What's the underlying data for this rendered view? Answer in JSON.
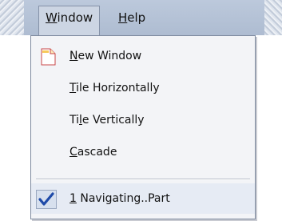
{
  "menubar": {
    "items": [
      {
        "label": "Window",
        "mnemonic": "W",
        "rest": "indow"
      },
      {
        "label": "Help",
        "mnemonic": "H",
        "rest": "elp"
      }
    ]
  },
  "window_menu": {
    "items": [
      {
        "label": "New Window",
        "mnemonic": "N",
        "rest": "ew Window",
        "icon": "new-window-icon"
      },
      {
        "label": "Tile Horizontally",
        "mnemonic": "T",
        "rest": "ile Horizontally"
      },
      {
        "label": "Tile Vertically",
        "pre": "Ti",
        "mnemonic": "l",
        "rest": "e Vertically"
      },
      {
        "label": "Cascade",
        "mnemonic": "C",
        "rest": "ascade"
      },
      {
        "label": "1 Navigating..Part",
        "mnemonic": "1",
        "rest": " Navigating..Part",
        "checked": true,
        "icon": "checkmark-icon"
      }
    ]
  },
  "colors": {
    "menubar_bg": "#b4c2d7",
    "menu_bg": "#f3f4f7",
    "check_blue": "#1e4aa8"
  }
}
